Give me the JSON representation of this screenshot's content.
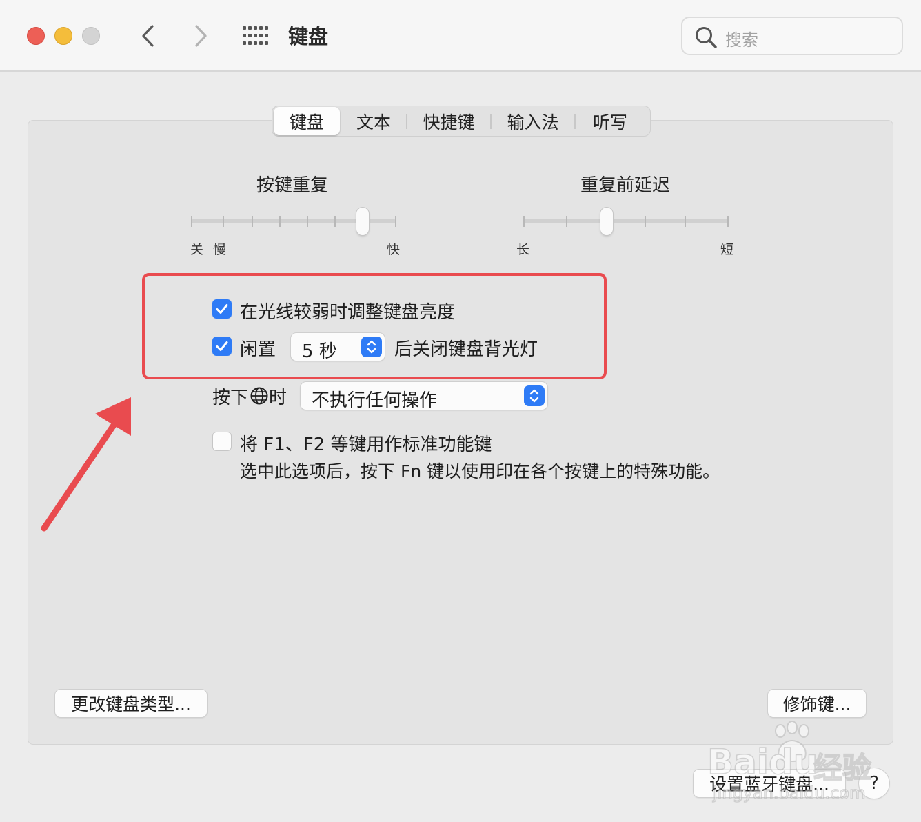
{
  "window": {
    "title": "键盘",
    "search_placeholder": "搜索"
  },
  "tabs": [
    {
      "label": "键盘",
      "active": true
    },
    {
      "label": "文本",
      "active": false
    },
    {
      "label": "快捷键",
      "active": false
    },
    {
      "label": "输入法",
      "active": false
    },
    {
      "label": "听写",
      "active": false
    }
  ],
  "key_repeat": {
    "label": "按键重复",
    "min_labels": [
      "关",
      "慢"
    ],
    "max_label": "快",
    "tick_count": 8,
    "value_fraction": 0.84
  },
  "delay_until_repeat": {
    "label": "重复前延迟",
    "min_label": "长",
    "max_label": "短",
    "tick_count": 6,
    "value_fraction": 0.4
  },
  "backlight": {
    "adjust_label": "在光线较弱时调整键盘亮度",
    "adjust_checked": true,
    "idle_checked": true,
    "idle_prefix": "闲置",
    "idle_value": "5 秒",
    "idle_suffix": "后关闭键盘背光灯"
  },
  "globe_key": {
    "prefix": "按下",
    "suffix": "时",
    "value": "不执行任何操作"
  },
  "fn_keys": {
    "checked": false,
    "label": "将 F1、F2 等键用作标准功能键",
    "description": "选中此选项后，按下 Fn 键以使用印在各个按键上的特殊功能。"
  },
  "buttons": {
    "change_keyboard_type": "更改键盘类型...",
    "modifier_keys": "修饰键...",
    "bluetooth_keyboard": "设置蓝牙键盘...",
    "help": "?"
  },
  "watermark": {
    "brand": "Baidu",
    "brand_cn": "经验",
    "url": "jingyan.baidu.com"
  },
  "colors": {
    "accent": "#2e7bf6",
    "highlight": "#e94b4f"
  }
}
